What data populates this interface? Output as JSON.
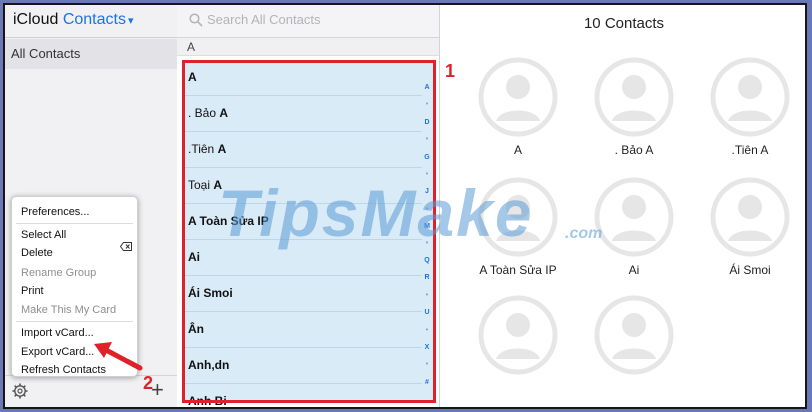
{
  "sidebar": {
    "brand_prefix": "iCloud",
    "brand_accent": "Contacts",
    "group_label": "All Contacts"
  },
  "menu": {
    "items": [
      {
        "label": "Preferences...",
        "disabled": false
      },
      {
        "label": "Select All",
        "disabled": false
      },
      {
        "label": "Delete",
        "disabled": false
      },
      {
        "label": "Rename Group",
        "disabled": true
      },
      {
        "label": "Print",
        "disabled": false
      },
      {
        "label": "Make This My Card",
        "disabled": true
      },
      {
        "label": "Import vCard...",
        "disabled": false
      },
      {
        "label": "Export vCard...",
        "disabled": false
      },
      {
        "label": "Refresh Contacts",
        "disabled": false
      }
    ]
  },
  "search": {
    "placeholder": "Search All Contacts"
  },
  "list": {
    "section": "A",
    "contacts": [
      {
        "pre": "",
        "bold": "A"
      },
      {
        "pre": ". Bảo ",
        "bold": "A"
      },
      {
        "pre": ".Tiên ",
        "bold": "A"
      },
      {
        "pre": "Toại ",
        "bold": "A"
      },
      {
        "pre": "",
        "bold": "A Toàn Sửa IP"
      },
      {
        "pre": "",
        "bold": "Ai"
      },
      {
        "pre": "",
        "bold": "Ái Smoi"
      },
      {
        "pre": "",
        "bold": "Ân"
      },
      {
        "pre": "",
        "bold": "Anh,dn"
      },
      {
        "pre": "",
        "bold": "Anh Bi"
      }
    ],
    "index": [
      "A",
      "•",
      "D",
      "•",
      "G",
      "•",
      "J",
      "•",
      "M",
      "•",
      "Q",
      "R",
      "•",
      "U",
      "•",
      "X",
      "•",
      "#"
    ]
  },
  "grid": {
    "title": "10 Contacts",
    "cards": [
      "A",
      ". Bảo A",
      ".Tiên A",
      "A Toàn Sửa IP",
      "Ai",
      "Ái Smoi",
      "",
      ""
    ]
  },
  "annotations": {
    "step1": "1",
    "step2": "2"
  },
  "watermark": {
    "text": "TipsMake",
    "suffix": ".com"
  },
  "colors": {
    "accent": "#1a73e8",
    "highlight": "#e0212a",
    "selection": "#d9ebf7",
    "frame_bg": "#6a78b8"
  }
}
